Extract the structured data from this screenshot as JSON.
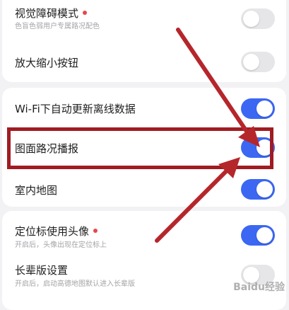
{
  "settings": {
    "visual_mode": {
      "label": "视觉障碍模式",
      "sub": "色盲色弱用户专属路况配色",
      "enabled": false,
      "new_dot": true
    },
    "zoom_buttons": {
      "label": "放大缩小按钮",
      "enabled": false
    },
    "wifi_update": {
      "label": "Wi-Fi下自动更新离线数据",
      "enabled": true
    },
    "map_traffic_report": {
      "label": "图面路况播报",
      "enabled": true
    },
    "indoor_map": {
      "label": "室内地图",
      "enabled": true
    },
    "avatar_locator": {
      "label": "定位标使用头像",
      "sub": "开启后，头像出现在定位标上",
      "enabled": true,
      "new_dot": true
    },
    "elder_mode": {
      "label": "长辈版设置",
      "sub": "开启后，启动高德地图默认进入长辈版",
      "enabled": false
    }
  },
  "annotation": {
    "highlight_color": "#a01c22",
    "highlighted_item": "map_traffic_report"
  },
  "watermark": {
    "text": "Baidu经验"
  },
  "colors": {
    "toggle_on": "#3b67f3",
    "toggle_off": "#e6e6e9",
    "badge": "#e5484d"
  }
}
